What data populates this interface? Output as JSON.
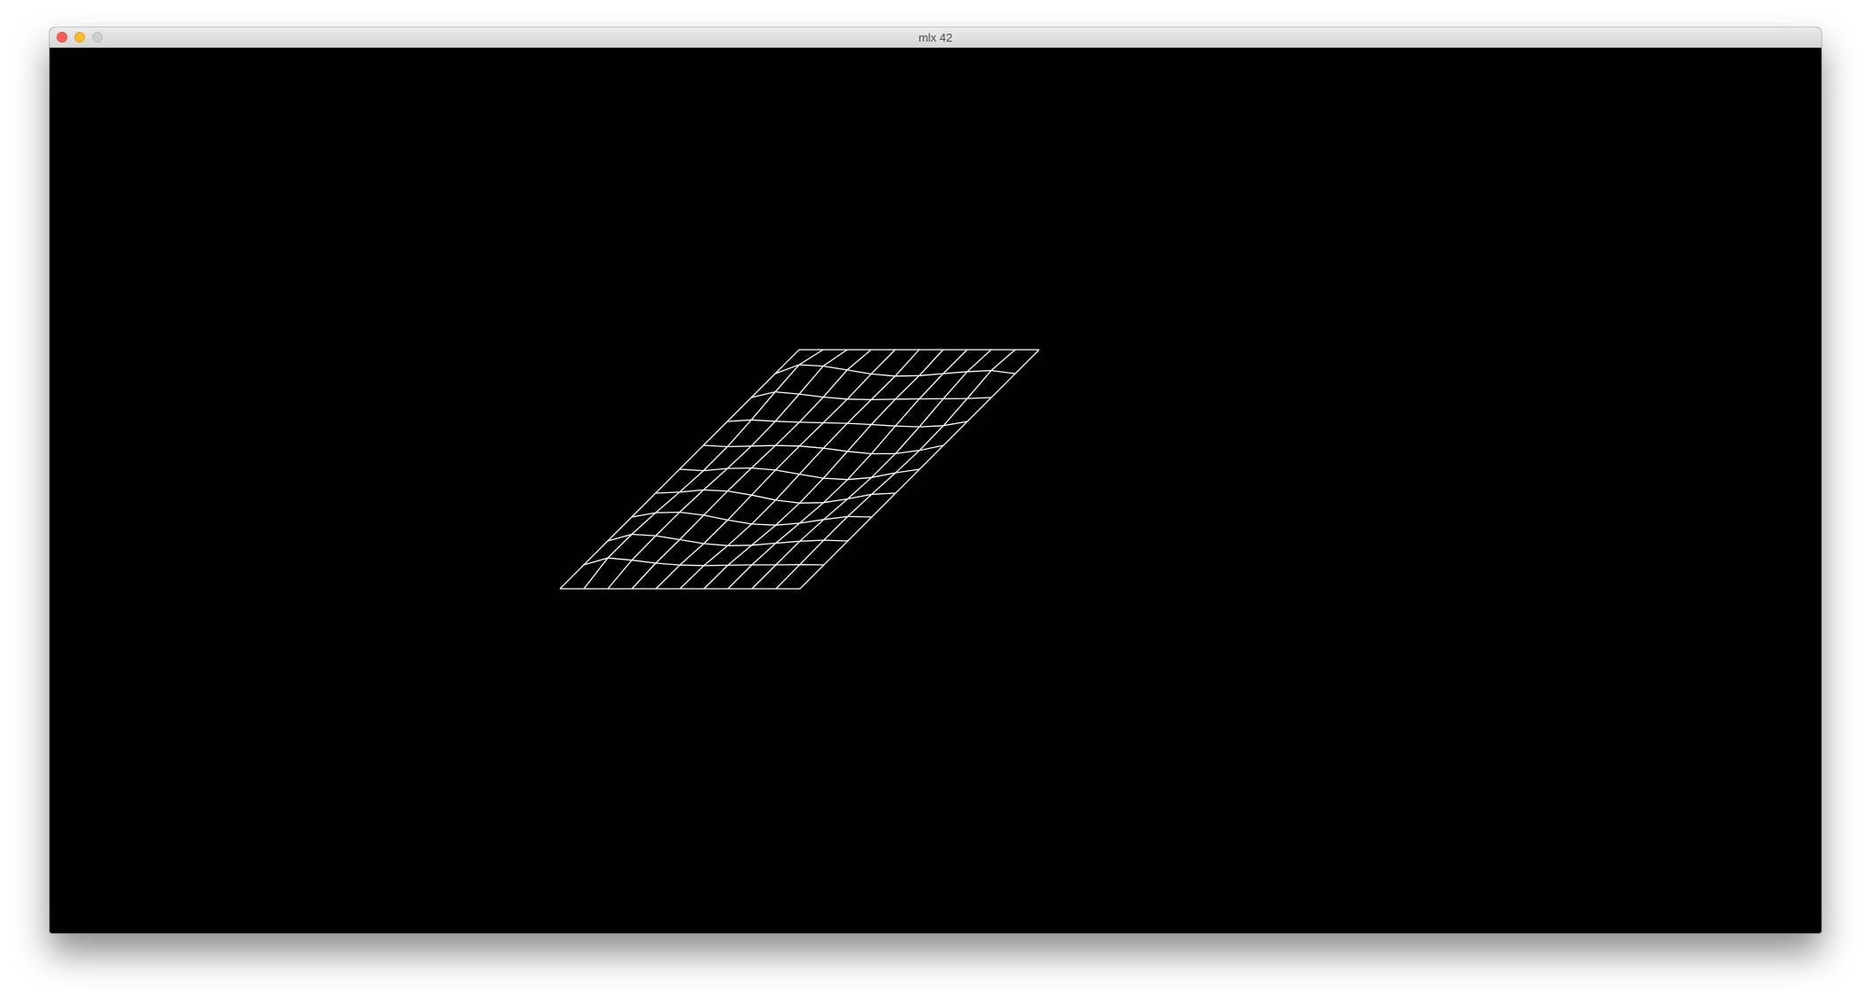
{
  "window": {
    "title": "mlx 42",
    "controls": {
      "close": {
        "icon": "close-traffic-light-icon",
        "color": "#fc5f57"
      },
      "minimize": {
        "icon": "minimize-traffic-light-icon",
        "color": "#fdbc2e"
      },
      "zoom": {
        "icon": "zoom-traffic-light-icon",
        "color": "#cfcfcf"
      }
    }
  },
  "canvas": {
    "background": "#000000",
    "line_color": "#ffffff",
    "wireframe": {
      "rows": 10,
      "cols": 10,
      "projection": "oblique"
    }
  }
}
